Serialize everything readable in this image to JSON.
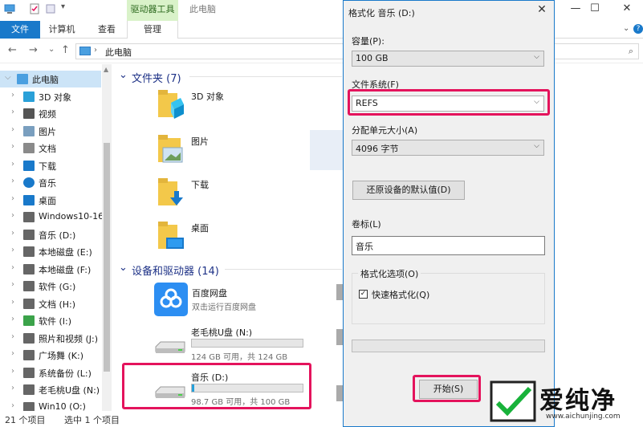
{
  "titlebar": {
    "context_tab": "驱动器工具",
    "title": "此电脑",
    "minimize": "—",
    "maximize": "☐",
    "close": "✕"
  },
  "ribbon": {
    "tabs": [
      "文件",
      "计算机",
      "查看",
      "管理"
    ],
    "help": "?"
  },
  "navbar": {
    "back": "←",
    "forward": "→",
    "recent": "⌄",
    "up": "↑",
    "address_sep": "›",
    "address_text": "此电脑",
    "search_icon": "⌕"
  },
  "sidebar": {
    "items": [
      {
        "label": "此电脑",
        "icon": "computer-icon",
        "color": "#4a9fe0"
      },
      {
        "label": "3D 对象",
        "icon": "cube-icon",
        "color": "#2aa0d8"
      },
      {
        "label": "视频",
        "icon": "video-icon",
        "color": "#555555"
      },
      {
        "label": "图片",
        "icon": "picture-icon",
        "color": "#7a9fbf"
      },
      {
        "label": "文档",
        "icon": "document-icon",
        "color": "#8a8a8a"
      },
      {
        "label": "下载",
        "icon": "download-icon",
        "color": "#1979ca"
      },
      {
        "label": "音乐",
        "icon": "music-icon",
        "color": "#1979ca"
      },
      {
        "label": "桌面",
        "icon": "desktop-icon",
        "color": "#1979ca"
      },
      {
        "label": "Windows10-16",
        "icon": "windows-drive-icon",
        "color": "#666666"
      },
      {
        "label": "音乐 (D:)",
        "icon": "drive-icon",
        "color": "#666666"
      },
      {
        "label": "本地磁盘 (E:)",
        "icon": "drive-icon",
        "color": "#666666"
      },
      {
        "label": "本地磁盘 (F:)",
        "icon": "drive-icon",
        "color": "#666666"
      },
      {
        "label": "软件 (G:)",
        "icon": "drive-icon",
        "color": "#666666"
      },
      {
        "label": "文档 (H:)",
        "icon": "drive-icon",
        "color": "#666666"
      },
      {
        "label": "软件 (I:)",
        "icon": "drive-icon",
        "color": "#3ba34a"
      },
      {
        "label": "照片和视频 (J:)",
        "icon": "drive-icon",
        "color": "#666666"
      },
      {
        "label": "广场舞 (K:)",
        "icon": "drive-icon",
        "color": "#666666"
      },
      {
        "label": "系统备份 (L:)",
        "icon": "drive-icon",
        "color": "#666666"
      },
      {
        "label": "老毛桃U盘 (N:)",
        "icon": "usb-drive-icon",
        "color": "#666666"
      },
      {
        "label": "Win10 (O:)",
        "icon": "drive-icon",
        "color": "#666666"
      }
    ]
  },
  "main": {
    "folders_header": "文件夹 (7)",
    "folders": [
      {
        "name": "3D 对象"
      },
      {
        "name": "图片"
      },
      {
        "name": "下载"
      },
      {
        "name": "桌面"
      }
    ],
    "devices_header": "设备和驱动器 (14)",
    "cloud": {
      "name": "百度网盘",
      "sub": "双击运行百度网盘"
    },
    "drives": [
      {
        "name": "老毛桃U盘 (N:)",
        "sub": "124 GB 可用，共 124 GB",
        "used_fraction": 0.0
      },
      {
        "name": "音乐 (D:)",
        "sub": "98.7 GB 可用，共 100 GB",
        "used_fraction": 0.013
      }
    ]
  },
  "status": {
    "count": "21 个项目",
    "selected": "选中 1 个项目"
  },
  "dialog": {
    "title": "格式化 音乐 (D:)",
    "close": "✕",
    "capacity_label": "容量(P):",
    "capacity_value": "100 GB",
    "fs_label": "文件系统(F)",
    "fs_value": "REFS",
    "alloc_label": "分配单元大小(A)",
    "alloc_value": "4096 字节",
    "restore_button": "还原设备的默认值(D)",
    "volume_label": "卷标(L)",
    "volume_value": "音乐",
    "options_legend": "格式化选项(O)",
    "quick_check": "✓",
    "quick_label": "快速格式化(Q)",
    "start_button": "开始(S)",
    "dropdown_arrow": "⌵"
  },
  "watermark": {
    "text": "爱纯净",
    "url": "www.aichunjing.com"
  },
  "colors": {
    "accent": "#1979ca",
    "highlight": "#e4135c",
    "progress": "#26a0da"
  }
}
